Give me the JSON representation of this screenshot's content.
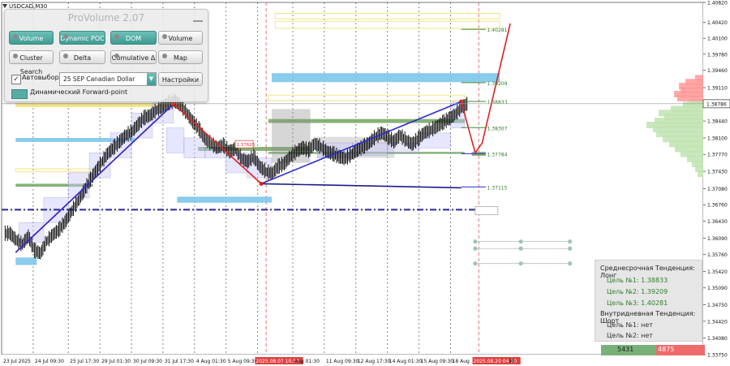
{
  "window": {
    "symbol": "USDCAD,M30"
  },
  "colors": {
    "bg": "#ffffff",
    "price_bar": "#111111",
    "red_line": "#e02020",
    "blue_line": "#2a2ad0",
    "navy_line": "#1c1c8a",
    "sky_zone": "#7cc6ea",
    "green_zone": "#7aa86a",
    "yellow_zone": "#f0e27a",
    "profile_red": "#ff9a9a",
    "profile_green": "#bfe3b0",
    "grid": "#555555"
  },
  "chart_data": {
    "type": "line",
    "y_range": [
      1.3375,
      1.4082
    ],
    "price_labels": [
      "1.40820",
      "1.40420",
      "1.40100",
      "1.39780",
      "1.39460",
      "1.39110",
      "1.38786",
      "1.38440",
      "1.38100",
      "1.37770",
      "1.37430",
      "1.37080",
      "1.36760",
      "1.36430",
      "1.36090",
      "1.35760",
      "1.35420",
      "1.35090",
      "1.34750",
      "1.34420",
      "1.34080",
      "1.33750"
    ],
    "current_price": "1.38786",
    "x_labels": [
      "23 Jul 2025",
      "24 Jul 09:30",
      "25 Jul 17:30",
      "29 Jul 01:30",
      "30 Jul 09:30",
      "31 Jul 17:30",
      "4 Aug 01:30",
      "5 Aug 09:30",
      "2025.08.07 10:30",
      "Aug 01:30",
      "11 Aug 09:30",
      "12 Aug 17:30",
      "14 Aug 01:30",
      "15 Aug 09:30",
      "18 Aug",
      "2025.08.20 04:30",
      "30"
    ],
    "close_prices": [
      1.3618,
      1.3605,
      1.3596,
      1.3612,
      1.3584,
      1.3578,
      1.3602,
      1.3615,
      1.3625,
      1.364,
      1.366,
      1.368,
      1.37,
      1.3722,
      1.3742,
      1.376,
      1.3778,
      1.379,
      1.3802,
      1.3815,
      1.3822,
      1.3836,
      1.385,
      1.3855,
      1.3865,
      1.3872,
      1.388,
      1.3884,
      1.3875,
      1.386,
      1.3842,
      1.3828,
      1.3808,
      1.3798,
      1.379,
      1.3795,
      1.3782,
      1.3788,
      1.3768,
      1.3762,
      1.3772,
      1.3752,
      1.3742,
      1.3738,
      1.3752,
      1.3758,
      1.3772,
      1.3782,
      1.379,
      1.3785,
      1.3798,
      1.3792,
      1.3782,
      1.3778,
      1.3772,
      1.3768,
      1.3776,
      1.3785,
      1.3792,
      1.38,
      1.3812,
      1.382,
      1.3812,
      1.3802,
      1.3815,
      1.3805,
      1.3797,
      1.3808,
      1.382,
      1.3825,
      1.3832,
      1.384,
      1.3848,
      1.3856,
      1.387,
      1.3878
    ],
    "levels": [
      {
        "label": "1.40281",
        "value": 1.40281
      },
      {
        "label": "1.39209",
        "value": 1.39209
      },
      {
        "label": "1.38833",
        "value": 1.38833
      },
      {
        "label": "1.38307",
        "value": 1.38307
      },
      {
        "label": "1.37784",
        "value": 1.37784
      },
      {
        "label": "1.37115",
        "value": 1.37115
      }
    ],
    "mid_label": "1.37625",
    "trend_lines": [
      {
        "color": "red",
        "points": [
          [
            0.02,
            1.358
          ],
          [
            0.245,
            1.3878
          ],
          [
            0.37,
            1.3718
          ]
        ]
      },
      {
        "color": "blue",
        "points": [
          [
            0.02,
            1.358
          ],
          [
            0.245,
            1.3878
          ]
        ]
      },
      {
        "color": "blue",
        "points": [
          [
            0.37,
            1.3718
          ],
          [
            0.655,
            1.3883
          ]
        ]
      },
      {
        "color": "navy",
        "points": [
          [
            0.37,
            1.3718
          ],
          [
            0.655,
            1.371
          ]
        ]
      },
      {
        "color": "red",
        "points": [
          [
            0.655,
            1.3883
          ],
          [
            0.675,
            1.378
          ],
          [
            0.685,
            1.38
          ],
          [
            0.725,
            1.404
          ]
        ]
      }
    ]
  },
  "pro_volume": {
    "title": "ProVolume 2.07",
    "buttons": {
      "volume_profile": "Volume Profile",
      "dynamic_poc": "Dynamic POC",
      "dom": "DOM",
      "volume": "Volume",
      "cluster_search": "Cluster Search",
      "delta": "Delta",
      "cumulative_delta": "Cumulative Δ",
      "map": "Map"
    },
    "auto_select_label": "Автовыбор",
    "contract": "25 SEP Canadian Dollar",
    "settings": "Настройки",
    "forward_point": "Динамический Forward-point",
    "check_mark": "✓",
    "arrow": "▼"
  },
  "trend_panel": {
    "medium_title": "Среднесрочная Тенденция: Лонг",
    "target1": "Цель №1:  1.38833",
    "target2": "Цель №2:  1.39209",
    "target3": "Цель №3:  1.40281",
    "intraday_title": "Внутридневная Тенденция: Шорт",
    "intraday_target1": "Цель №1:  нет",
    "intraday_target2": "Цель №2:  нет"
  },
  "delta_bar": {
    "buy": "5431",
    "sell": "4875"
  }
}
